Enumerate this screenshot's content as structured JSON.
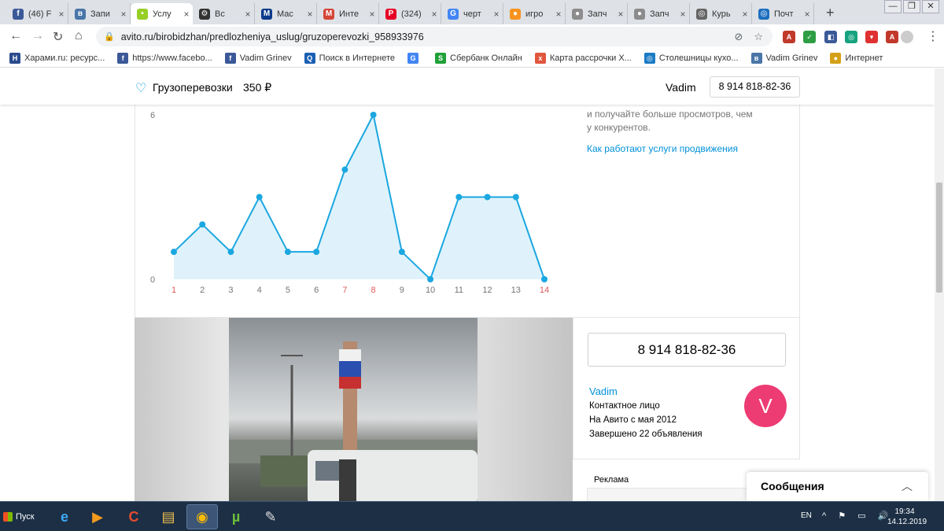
{
  "tabs": [
    {
      "title": "(46) F",
      "icon": "facebook-icon",
      "color": "#3b5998",
      "glyph": "f"
    },
    {
      "title": "Запи",
      "icon": "vk-icon",
      "color": "#4a76a8",
      "glyph": "в"
    },
    {
      "title": "Услу",
      "icon": "avito-icon",
      "color": "#97cf26",
      "glyph": "•",
      "active": true
    },
    {
      "title": "Вс",
      "icon": "gear-icon",
      "color": "#333333",
      "glyph": "⚙"
    },
    {
      "title": "Мас",
      "icon": "master-icon",
      "color": "#0b3a8a",
      "glyph": "M"
    },
    {
      "title": "Инте",
      "icon": "gmail-icon",
      "color": "#d44638",
      "glyph": "M"
    },
    {
      "title": "(324)",
      "icon": "pinterest-icon",
      "color": "#e60023",
      "glyph": "P"
    },
    {
      "title": "черт",
      "icon": "google-icon",
      "color": "#4285f4",
      "glyph": "G"
    },
    {
      "title": "игро",
      "icon": "game-icon",
      "color": "#f7931e",
      "glyph": "●"
    },
    {
      "title": "Запч",
      "icon": "car-icon",
      "color": "#8c8c8c",
      "glyph": "●"
    },
    {
      "title": "Запч",
      "icon": "car-icon",
      "color": "#8c8c8c",
      "glyph": "●"
    },
    {
      "title": "Курь",
      "icon": "globe-icon",
      "color": "#666666",
      "glyph": "◎"
    },
    {
      "title": "Почт",
      "icon": "mail-icon",
      "color": "#1e6fbf",
      "glyph": "◎"
    }
  ],
  "address": {
    "url": "avito.ru/birobidzhan/predlozheniya_uslug/gruzoperevozki_958933976"
  },
  "bookmarks": [
    {
      "label": "Харами.ru: ресурс...",
      "color": "#2a4b8d",
      "glyph": "H"
    },
    {
      "label": "https://www.facebo...",
      "color": "#3b5998",
      "glyph": "f"
    },
    {
      "label": "Vadim Grinev",
      "color": "#3b5998",
      "glyph": "f"
    },
    {
      "label": "Поиск в Интернете",
      "color": "#1b5fb3",
      "glyph": "Q"
    },
    {
      "label": "",
      "color": "#4285f4",
      "glyph": "G"
    },
    {
      "label": "Сбербанк Онлайн",
      "color": "#21a038",
      "glyph": "S"
    },
    {
      "label": "Карта рассрочки Х...",
      "color": "#e2553d",
      "glyph": "x"
    },
    {
      "label": "Столешницы кухо...",
      "color": "#1b7bc4",
      "glyph": "◎"
    },
    {
      "label": "Vadim Grinev",
      "color": "#4a76a8",
      "glyph": "в"
    },
    {
      "label": "Интернет",
      "color": "#d4a017",
      "glyph": "●"
    }
  ],
  "sticky": {
    "title": "Грузоперевозки",
    "price": "350 ₽",
    "seller_name": "Vadim",
    "phone": "8 914 818-82-36"
  },
  "promo": {
    "text_line1": "и получайте больше просмотров, чем",
    "text_line2": "у конкурентов.",
    "link": "Как работают услуги продвижения"
  },
  "chart_data": {
    "type": "area",
    "x": [
      1,
      2,
      3,
      4,
      5,
      6,
      7,
      8,
      9,
      10,
      11,
      12,
      13,
      14
    ],
    "values": [
      1,
      2,
      1,
      3,
      1,
      1,
      4,
      6,
      1,
      0,
      3,
      3,
      3,
      0
    ],
    "ylim": [
      0,
      6
    ],
    "ytick_labels": [
      "0",
      "6"
    ],
    "weekend_x": [
      1,
      7,
      8,
      14
    ],
    "line_color": "#1ba7e0",
    "fill_color": "#dff2fb",
    "weekend_tick_color": "#e05a5a",
    "tick_color": "#757575"
  },
  "seller": {
    "phone": "8 914 818-82-36",
    "name": "Vadim",
    "role": "Контактное лицо",
    "since": "На Авито с мая 2012",
    "completed": "Завершено 22 объявления",
    "avatar_letter": "V"
  },
  "ad": {
    "label": "Реклама"
  },
  "messages": {
    "title": "Сообщения"
  },
  "taskbar": {
    "start_label": "Пуск",
    "lang": "EN",
    "time": "19:34",
    "date": "14.12.2019"
  }
}
